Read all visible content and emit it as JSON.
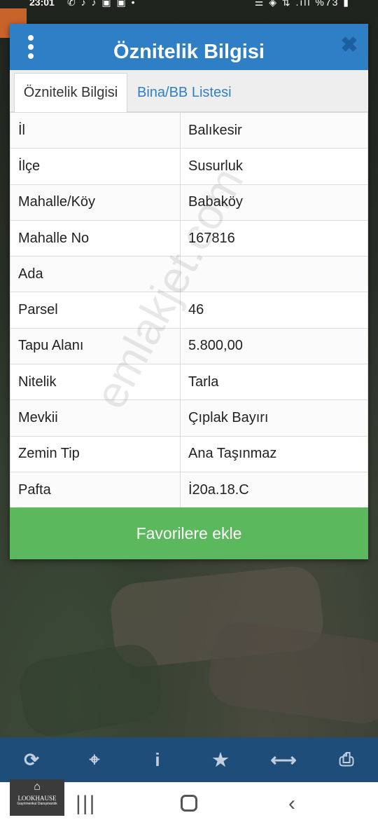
{
  "status_bar": {
    "time": "23:01",
    "left_icons": "✆ ♪ ♪ ▣ ▣ •",
    "right_icons": "☰ ◈ ⇅ .ıll %73 ▮"
  },
  "dialog": {
    "title": "Öznitelik Bilgisi",
    "tabs": [
      {
        "label": "Öznitelik Bilgisi",
        "active": true
      },
      {
        "label": "Bina/BB Listesi",
        "active": false
      }
    ],
    "rows": [
      {
        "key": "İl",
        "value": "Balıkesir"
      },
      {
        "key": "İlçe",
        "value": "Susurluk"
      },
      {
        "key": "Mahalle/Köy",
        "value": "Babaköy"
      },
      {
        "key": "Mahalle No",
        "value": "167816"
      },
      {
        "key": "Ada",
        "value": ""
      },
      {
        "key": "Parsel",
        "value": "46"
      },
      {
        "key": "Tapu Alanı",
        "value": "5.800,00"
      },
      {
        "key": "Nitelik",
        "value": "Tarla"
      },
      {
        "key": "Mevkii",
        "value": "Çıplak Bayırı"
      },
      {
        "key": "Zemin Tip",
        "value": "Ana Taşınmaz"
      },
      {
        "key": "Pafta",
        "value": "İ20a.18.C"
      }
    ],
    "favorite_button": "Favorilere ekle"
  },
  "watermark": "emlakjet.com",
  "toolbar": {
    "items": [
      {
        "icon": "refresh-icon",
        "glyph": "⟳"
      },
      {
        "icon": "locate-icon",
        "glyph": "⌖"
      },
      {
        "icon": "info-icon",
        "glyph": "i"
      },
      {
        "icon": "star-icon",
        "glyph": "★"
      },
      {
        "icon": "measure-icon",
        "glyph": "⟷"
      },
      {
        "icon": "print-icon",
        "glyph": "⎙"
      }
    ]
  },
  "navbar": {
    "recent": "|||",
    "back": "‹"
  },
  "logo": {
    "mark": "⌂",
    "name": "LOOKHAUSE",
    "sub": "Gayrimenkul Danışmanlık"
  },
  "colors": {
    "header": "#2f7fc6",
    "button": "#5cb85c",
    "toolbar": "#1f4d7a"
  }
}
